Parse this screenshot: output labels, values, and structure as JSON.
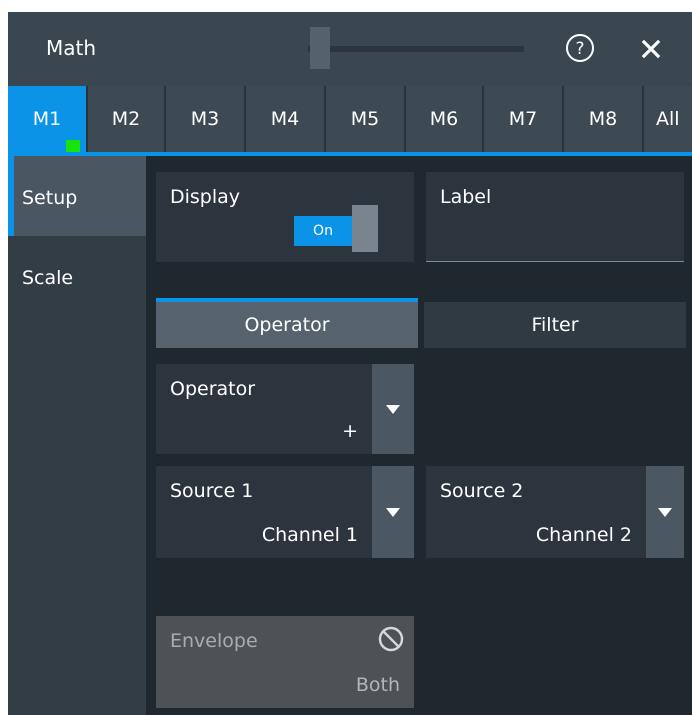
{
  "window": {
    "title": "Math",
    "help_icon": "help-circle-icon",
    "close_icon": "close-icon"
  },
  "tabs": [
    {
      "label": "M1",
      "active": true
    },
    {
      "label": "M2",
      "active": false
    },
    {
      "label": "M3",
      "active": false
    },
    {
      "label": "M4",
      "active": false
    },
    {
      "label": "M5",
      "active": false
    },
    {
      "label": "M6",
      "active": false
    },
    {
      "label": "M7",
      "active": false
    },
    {
      "label": "M8",
      "active": false
    },
    {
      "label": "All",
      "active": false
    }
  ],
  "nav": {
    "items": [
      {
        "label": "Setup",
        "active": true
      },
      {
        "label": "Scale",
        "active": false
      }
    ]
  },
  "display": {
    "label": "Display",
    "toggle_value": "On"
  },
  "label_field": {
    "label": "Label",
    "value": ""
  },
  "subtabs": [
    {
      "label": "Operator",
      "active": true
    },
    {
      "label": "Filter",
      "active": false
    }
  ],
  "operator": {
    "label": "Operator",
    "value": "+"
  },
  "source1": {
    "label": "Source 1",
    "value": "Channel 1"
  },
  "source2": {
    "label": "Source 2",
    "value": "Channel 2"
  },
  "envelope": {
    "label": "Envelope",
    "value": "Both",
    "disabled": true,
    "icon": "no-entry-icon"
  },
  "colors": {
    "accent": "#0a93e7",
    "active_indicator": "#17e30c"
  }
}
